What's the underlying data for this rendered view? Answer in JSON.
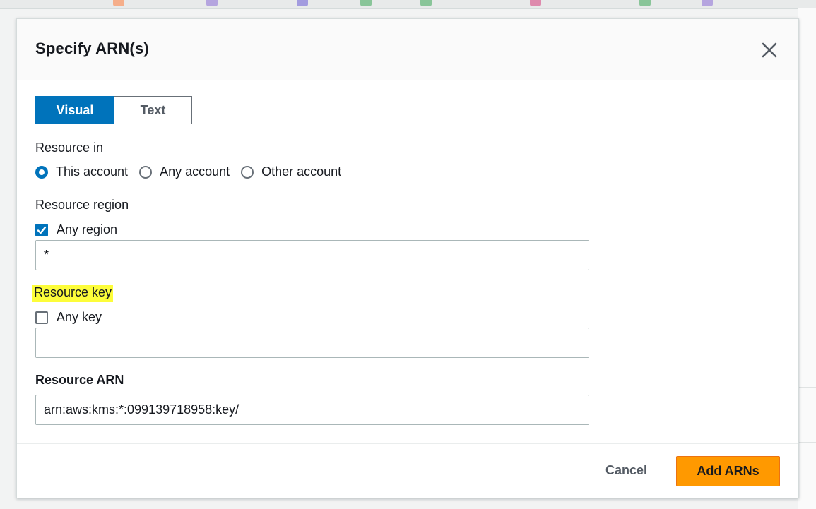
{
  "modal": {
    "title": "Specify ARN(s)",
    "close_icon": "close-icon"
  },
  "mode_toggle": {
    "options": [
      {
        "label": "Visual",
        "selected": true
      },
      {
        "label": "Text",
        "selected": false
      }
    ]
  },
  "resource_in": {
    "label": "Resource in",
    "options": [
      {
        "label": "This account",
        "selected": true
      },
      {
        "label": "Any account",
        "selected": false
      },
      {
        "label": "Other account",
        "selected": false
      }
    ]
  },
  "resource_region": {
    "label": "Resource region",
    "checkbox_label": "Any region",
    "checked": true,
    "value": "*"
  },
  "resource_key": {
    "label": "Resource key",
    "checkbox_label": "Any key",
    "checked": false,
    "value": ""
  },
  "resource_arn": {
    "label": "Resource ARN",
    "value": "arn:aws:kms:*:099139718958:key/"
  },
  "footer": {
    "cancel_label": "Cancel",
    "add_label": "Add ARNs"
  },
  "colors": {
    "accent": "#0073bb",
    "primary_button": "#ff9900",
    "highlight": "#fdfd3a"
  }
}
